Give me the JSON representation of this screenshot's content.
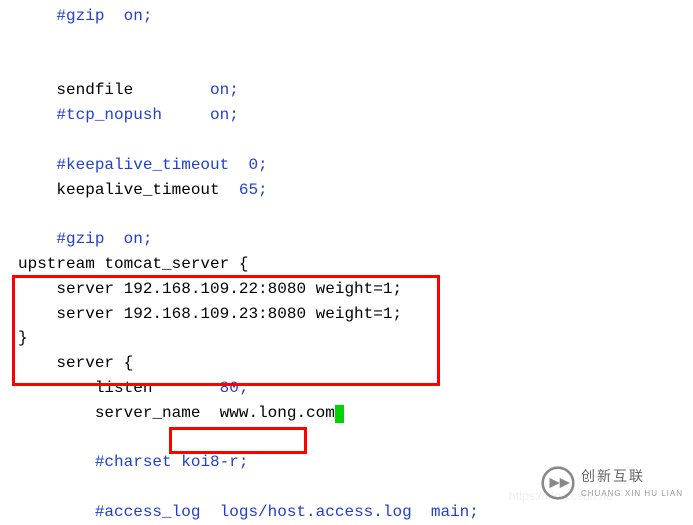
{
  "code": {
    "indent4": "    ",
    "indent8": "        ",
    "gzip_on1": "#gzip  on;",
    "sendfile_key": "sendfile",
    "sendfile_pad": "        ",
    "sendfile_val": "on;",
    "tcp_nopush_key": "#tcp_nopush",
    "tcp_nopush_pad": "     ",
    "tcp_nopush_val": "on;",
    "katimeout_c_key": "#keepalive_timeout",
    "katimeout_c_pad": "  ",
    "katimeout_c_val": "0;",
    "katimeout_key": "keepalive_timeout",
    "katimeout_pad": "  ",
    "katimeout_val": "65;",
    "gzip_on2": "#gzip  on;",
    "upstream_open": "upstream tomcat_server {",
    "server1": "server 192.168.109.22:8080 weight=1;",
    "server2": "server 192.168.109.23:8080 weight=1;",
    "brace_close": "}",
    "server_open": "server {",
    "listen_key": "listen",
    "listen_pad": "       ",
    "listen_val": "80;",
    "sname_key": "server_name",
    "sname_pad": "  ",
    "sname_val": "www.long.com",
    "sname_semi": ";",
    "charset_key": "#charset",
    "charset_pad": " ",
    "charset_val": "koi8-r;",
    "alog_key": "#access_log",
    "alog_pad": "  ",
    "alog_path": "logs/host.access.log",
    "alog_pad2": "  ",
    "alog_main": "main;"
  },
  "brand": {
    "cn": "创新互联",
    "en": "CHUANG XIN HU LIAN"
  },
  "watermark": "https://blog.csdn.ne"
}
